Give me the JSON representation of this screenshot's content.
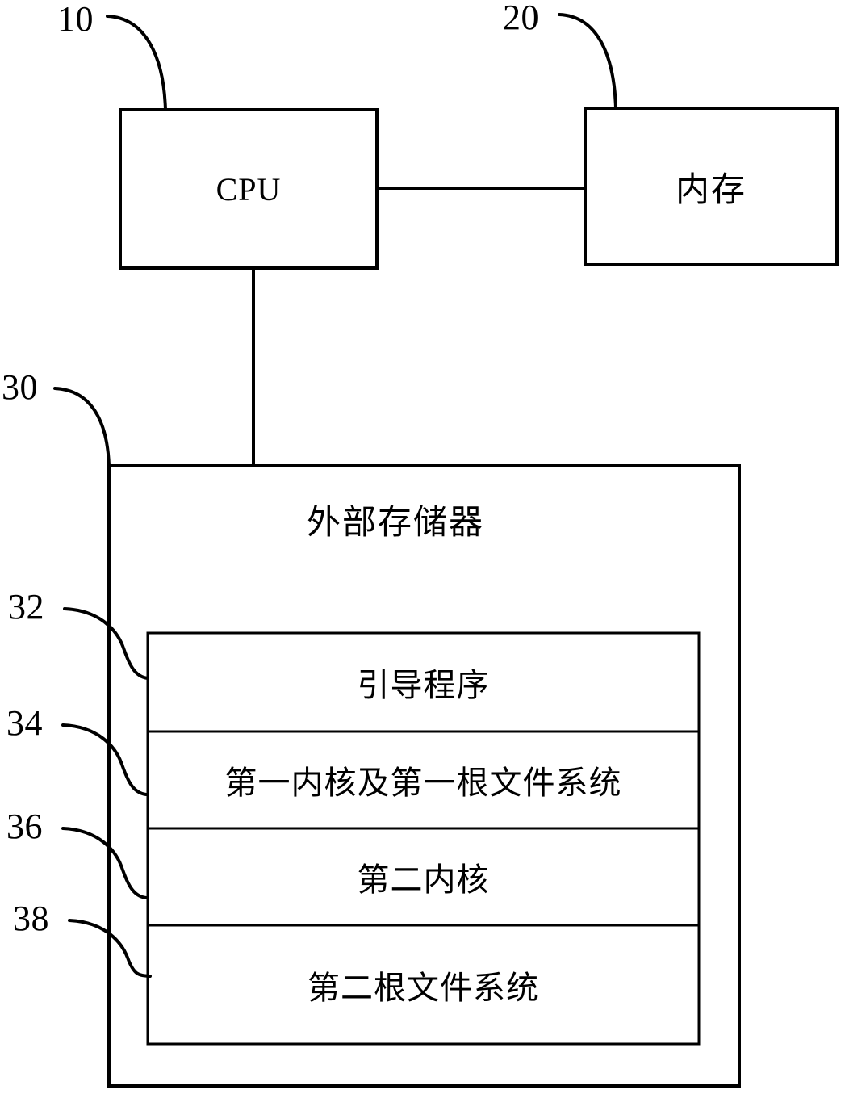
{
  "figure": {
    "title": "Computer system architecture block diagram",
    "language": "zh-CN",
    "line_color": "#000000",
    "background_color": "#ffffff"
  },
  "blocks": {
    "cpu": {
      "ref": "10",
      "label": "CPU"
    },
    "memory": {
      "ref": "20",
      "label": "内存"
    },
    "external_storage": {
      "ref": "30",
      "label": "外部存储器",
      "partitions": [
        {
          "ref": "32",
          "label": "引导程序"
        },
        {
          "ref": "34",
          "label": "第一内核及第一根文件系统"
        },
        {
          "ref": "36",
          "label": "第二内核"
        },
        {
          "ref": "38",
          "label": "第二根文件系统"
        }
      ]
    }
  },
  "connections": [
    {
      "from": "cpu",
      "to": "memory",
      "style": "horizontal-line"
    },
    {
      "from": "cpu",
      "to": "external_storage",
      "style": "vertical-line"
    }
  ],
  "leaders": [
    {
      "ref": "10",
      "target": "cpu"
    },
    {
      "ref": "20",
      "target": "memory"
    },
    {
      "ref": "30",
      "target": "external_storage"
    },
    {
      "ref": "32",
      "target": "partition-boot-program"
    },
    {
      "ref": "34",
      "target": "partition-first-kernel"
    },
    {
      "ref": "36",
      "target": "partition-second-kernel"
    },
    {
      "ref": "38",
      "target": "partition-second-rootfs"
    }
  ]
}
